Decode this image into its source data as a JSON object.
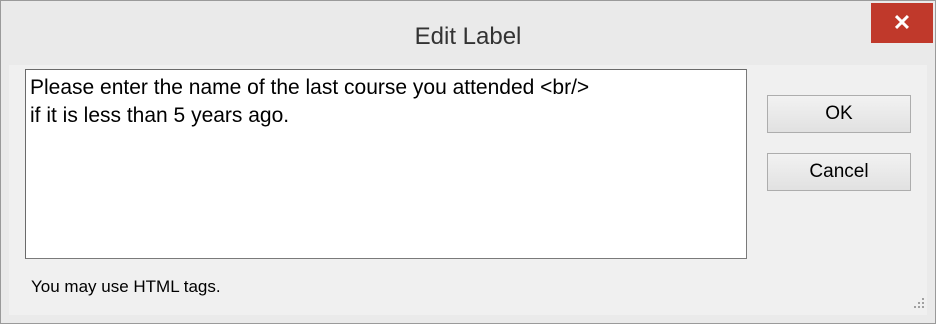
{
  "window": {
    "title": "Edit Label",
    "close_glyph": "✕"
  },
  "editor": {
    "value": "Please enter the name of the last course you attended <br/>\nif it is less than 5 years ago."
  },
  "buttons": {
    "ok_label": "OK",
    "cancel_label": "Cancel"
  },
  "hint": "You may use HTML tags.",
  "colors": {
    "close_button": "#c0392b",
    "window_bg": "#f0f0f0"
  },
  "icons": {
    "close": "close-icon",
    "resize": "resize-grip-icon"
  }
}
